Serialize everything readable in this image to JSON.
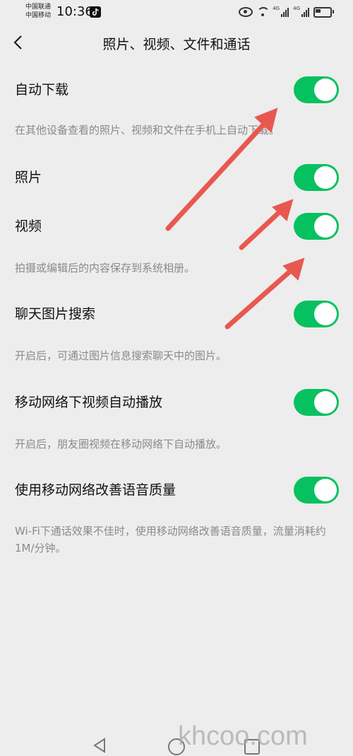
{
  "status_bar": {
    "carrier_1": "中国联通",
    "carrier_2": "中国移动",
    "time": "10:36",
    "net_1": "4G",
    "net_2": "4G"
  },
  "header": {
    "title": "照片、视频、文件和通话"
  },
  "settings": {
    "auto_download": {
      "label": "自动下载",
      "enabled": true,
      "description": "在其他设备查看的照片、视频和文件在手机上自动下载。"
    },
    "photos": {
      "label": "照片",
      "enabled": true
    },
    "videos": {
      "label": "视频",
      "enabled": true,
      "description": "拍摄或编辑后的内容保存到系统相册。"
    },
    "chat_image_search": {
      "label": "聊天图片搜索",
      "enabled": true,
      "description": "开启后，可通过图片信息搜索聊天中的图片。"
    },
    "mobile_autoplay": {
      "label": "移动网络下视频自动播放",
      "enabled": true,
      "description": "开启后，朋友圈视频在移动网络下自动播放。"
    },
    "voice_quality": {
      "label": "使用移动网络改善语音质量",
      "enabled": true,
      "description": "Wi-Fi下通话效果不佳时，使用移动网络改善语音质量，流量消耗约1M/分钟。"
    }
  },
  "colors": {
    "toggle_on": "#07c160",
    "arrow": "#e8584f",
    "background": "#ededed"
  },
  "watermark": "khcoo.com"
}
